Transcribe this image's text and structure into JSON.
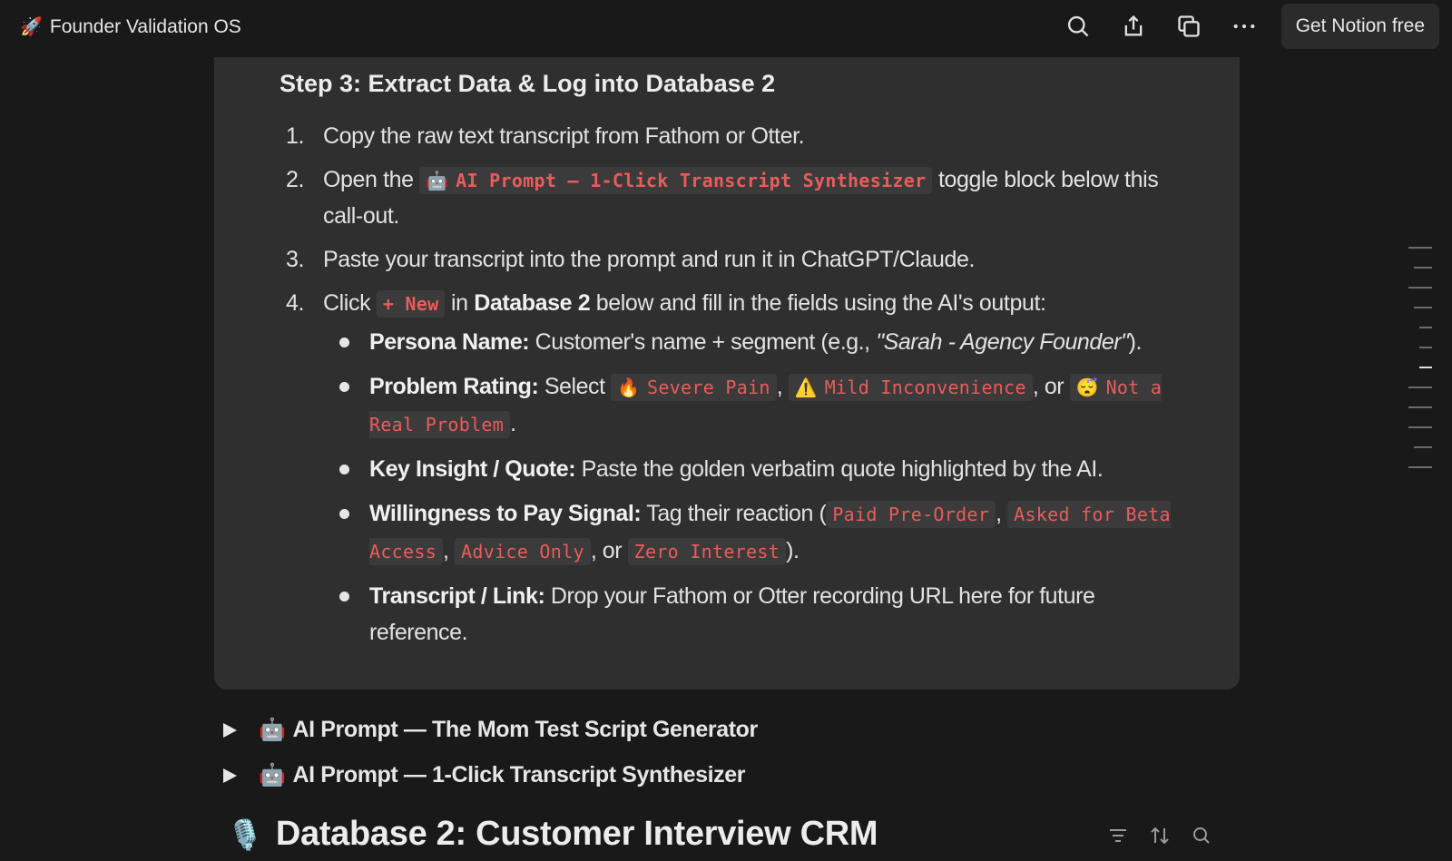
{
  "topbar": {
    "page_title": "Founder Validation OS",
    "page_icon": "rocket-icon",
    "cta_label": "Get Notion free"
  },
  "callout": {
    "title": "Step 3: Extract Data & Log into Database 2",
    "steps": [
      {
        "num": "1.",
        "text": "Copy the raw text transcript from Fathom or Otter."
      },
      {
        "num": "2.",
        "pre": "Open the ",
        "chip": "AI Prompt — 1-Click Transcript Synthesizer",
        "post": " toggle block below this call-out."
      },
      {
        "num": "3.",
        "text": "Paste your transcript into the prompt and run it in ChatGPT/Claude."
      },
      {
        "num": "4.",
        "pre": "Click ",
        "chip": "+ New",
        "mid": " in ",
        "bold": "Database 2",
        "post": " below and fill in the fields using the AI's output:"
      }
    ],
    "fields": {
      "persona": {
        "label": "Persona Name:",
        "text": " Customer's name + segment (e.g., ",
        "example": "\"Sarah - Agency Founder\"",
        "end": ")."
      },
      "problem": {
        "label": "Problem Rating:",
        "text": " Select ",
        "opt1": "Severe Pain",
        "opt2": "Mild Inconvenience",
        "or": ", or ",
        "opt3": "Not a Real Problem",
        "end": "."
      },
      "insight": {
        "label": "Key Insight / Quote:",
        "text": " Paste the golden verbatim quote highlighted by the AI."
      },
      "wtp": {
        "label": "Willingness to Pay Signal:",
        "text": " Tag their reaction (",
        "opt1": "Paid Pre-Order",
        "opt2": "Asked for Beta Access",
        "opt3": "Advice Only",
        "or": ", or ",
        "opt4": "Zero Interest",
        "end": ")."
      },
      "transcript": {
        "label": "Transcript / Link:",
        "text": " Drop your Fathom or Otter recording URL here for future reference."
      }
    }
  },
  "toggles": [
    {
      "label": "AI Prompt — The Mom Test Script Generator"
    },
    {
      "label": "AI Prompt — 1-Click Transcript Synthesizer"
    }
  ],
  "database": {
    "title": "Database 2: Customer Interview CRM"
  },
  "colors": {
    "background": "#191919",
    "callout": "#2f2f2f",
    "code_text": "#ea5b5b"
  }
}
